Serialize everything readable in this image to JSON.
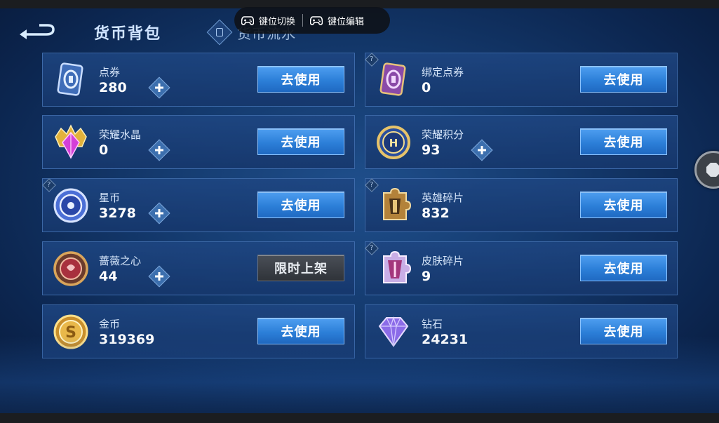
{
  "header": {
    "title": "货币背包",
    "tab_flow": "货币流水"
  },
  "toolbar": {
    "key_switch": "键位切换",
    "key_edit": "键位编辑"
  },
  "cards": [
    {
      "name": "点券",
      "amount": "280",
      "button": "去使用",
      "icon": "coupon-card-icon",
      "has_plus": true,
      "has_help": false
    },
    {
      "name": "绑定点券",
      "amount": "0",
      "button": "去使用",
      "icon": "bound-coupon-card-icon",
      "has_plus": false,
      "has_help": true
    },
    {
      "name": "荣耀水晶",
      "amount": "0",
      "button": "去使用",
      "icon": "glory-crystal-icon",
      "has_plus": true,
      "has_help": false
    },
    {
      "name": "荣耀积分",
      "amount": "93",
      "button": "去使用",
      "icon": "glory-points-icon",
      "has_plus": true,
      "has_help": false
    },
    {
      "name": "星币",
      "amount": "3278",
      "button": "去使用",
      "icon": "star-coin-icon",
      "has_plus": true,
      "has_help": true
    },
    {
      "name": "英雄碎片",
      "amount": "832",
      "button": "去使用",
      "icon": "hero-fragment-icon",
      "has_plus": false,
      "has_help": true
    },
    {
      "name": "蔷薇之心",
      "amount": "44",
      "button": "限时上架",
      "icon": "rose-heart-icon",
      "has_plus": true,
      "has_help": false
    },
    {
      "name": "皮肤碎片",
      "amount": "9",
      "button": "去使用",
      "icon": "skin-fragment-icon",
      "has_plus": false,
      "has_help": true
    },
    {
      "name": "金币",
      "amount": "319369",
      "button": "去使用",
      "icon": "gold-coin-icon",
      "has_plus": false,
      "has_help": false
    },
    {
      "name": "钻石",
      "amount": "24231",
      "button": "去使用",
      "icon": "diamond-icon",
      "has_plus": false,
      "has_help": false
    }
  ],
  "colors": {
    "accent_button": "#2c7fd8",
    "background": "#143a6e",
    "card": "#1e4682"
  }
}
